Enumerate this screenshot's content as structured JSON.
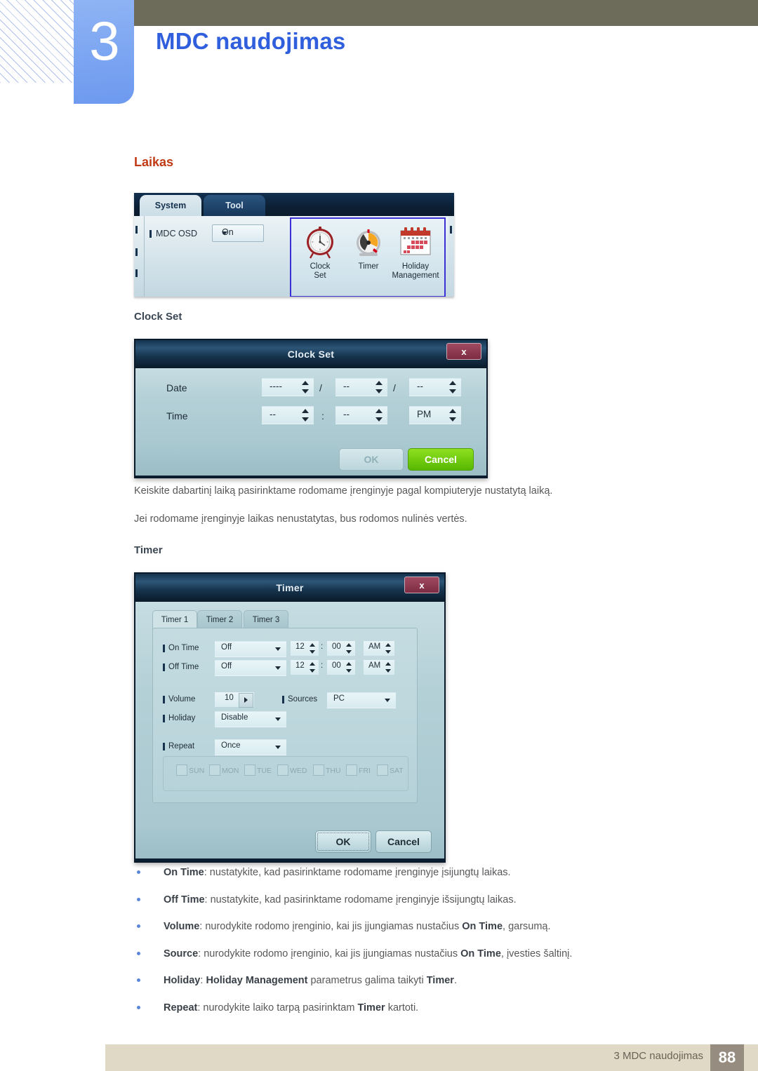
{
  "header": {
    "chapter_number": "3",
    "chapter_title": "MDC naudojimas"
  },
  "section": {
    "heading": "Laikas",
    "sub_clock_set": "Clock Set",
    "sub_timer": "Timer",
    "paragraph_1": "Keiskite dabartinį laiką pasirinktame rodomame įrenginyje pagal kompiuteryje nustatytą laiką.",
    "paragraph_2": "Jei rodomame įrenginyje laikas nenustatytas, bus rodomos nulinės vertės."
  },
  "ribbon": {
    "tabs": [
      {
        "label": "System",
        "active": true
      },
      {
        "label": "Tool",
        "active": false
      }
    ],
    "mdc_osd_label": "MDC OSD",
    "mdc_osd_value": "On",
    "icons": [
      {
        "name": "clock-set-icon",
        "line1": "Clock",
        "line2": "Set"
      },
      {
        "name": "timer-icon",
        "line1": "Timer",
        "line2": ""
      },
      {
        "name": "holiday-management-icon",
        "line1": "Holiday",
        "line2": "Management"
      }
    ]
  },
  "clock_set_dialog": {
    "title": "Clock Set",
    "close_label": "x",
    "date_label": "Date",
    "time_label": "Time",
    "date_year": "----",
    "date_month": "--",
    "date_day": "--",
    "date_sep_1": "/",
    "date_sep_2": "/",
    "time_hour": "--",
    "time_minute": "--",
    "time_meridiem": "PM",
    "time_sep": ":",
    "ok_label": "OK",
    "cancel_label": "Cancel"
  },
  "timer_dialog": {
    "title": "Timer",
    "close_label": "x",
    "tabs": [
      "Timer 1",
      "Timer 2",
      "Timer 3"
    ],
    "on_time_label": "On Time",
    "on_time_value": "Off",
    "on_time_hour": "12",
    "on_time_minute": "00",
    "on_time_meridiem": "AM",
    "off_time_label": "Off Time",
    "off_time_value": "Off",
    "off_time_hour": "12",
    "off_time_minute": "00",
    "off_time_meridiem": "AM",
    "colon": ":",
    "volume_label": "Volume",
    "volume_value": "10",
    "sources_label": "Sources",
    "sources_value": "PC",
    "holiday_label": "Holiday",
    "holiday_value": "Disable",
    "repeat_label": "Repeat",
    "repeat_value": "Once",
    "days": [
      "SUN",
      "MON",
      "TUE",
      "WED",
      "THU",
      "FRI",
      "SAT"
    ],
    "ok_label": "OK",
    "cancel_label": "Cancel"
  },
  "bullets": [
    {
      "term": "On Time",
      "rest": ": nustatykite, kad pasirinktame rodomame įrenginyje įsijungtų laikas."
    },
    {
      "term": "Off Time",
      "rest": ": nustatykite, kad pasirinktame rodomame įrenginyje išsijungtų laikas."
    },
    {
      "term": "Volume",
      "rest": ": nurodykite rodomo įrenginio, kai jis įjungiamas nustačius ",
      "term2": "On Time",
      "rest2": ", garsumą."
    },
    {
      "term": "Source",
      "rest": ": nurodykite rodomo įrenginio, kai jis įjungiamas nustačius ",
      "term2": "On Time",
      "rest2": ", įvesties šaltinį."
    },
    {
      "term": "Holiday",
      "rest": ": ",
      "term2": "Holiday Management",
      "rest2": " parametrus galima taikyti ",
      "term3": "Timer",
      "rest3": "."
    },
    {
      "term": "Repeat",
      "rest": ": nurodykite laiko tarpą pasirinktam ",
      "term2": "Timer",
      "rest2": " kartoti."
    }
  ],
  "footer": {
    "text": "3 MDC naudojimas",
    "page": "88"
  },
  "colors": {
    "chapter_blue": "#2f5fdc",
    "chapter_block": "#7fa8f2",
    "olive": "#6d6b59",
    "heading_orange": "#c03a14",
    "body_gray": "#58585a",
    "bullet_dot": "#5b86d8",
    "footer_bar": "#dfd9c5",
    "footer_page": "#978c80",
    "dialog_accent": "#3b2fd6",
    "cancel_green": "#57b800"
  }
}
